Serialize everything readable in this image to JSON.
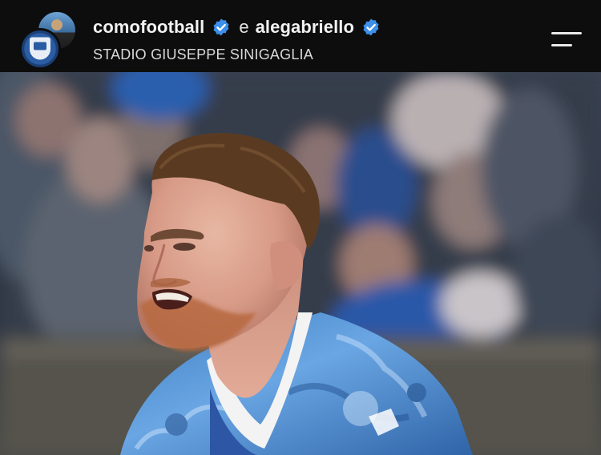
{
  "post_header": {
    "owner_username": "comofootball",
    "connector": "e",
    "collaborator_username": "alegabriello",
    "location": "STADIO GIUSEPPE SINIGAGLIA",
    "verified_color": "#3d8fea"
  },
  "icons": {
    "menu": "menu-icon",
    "verified": "verified-badge-icon"
  },
  "photo": {
    "subject": "football player shouting in celebration",
    "kit_color": "#4b8fd6",
    "background": "blurred stadium crowd"
  }
}
